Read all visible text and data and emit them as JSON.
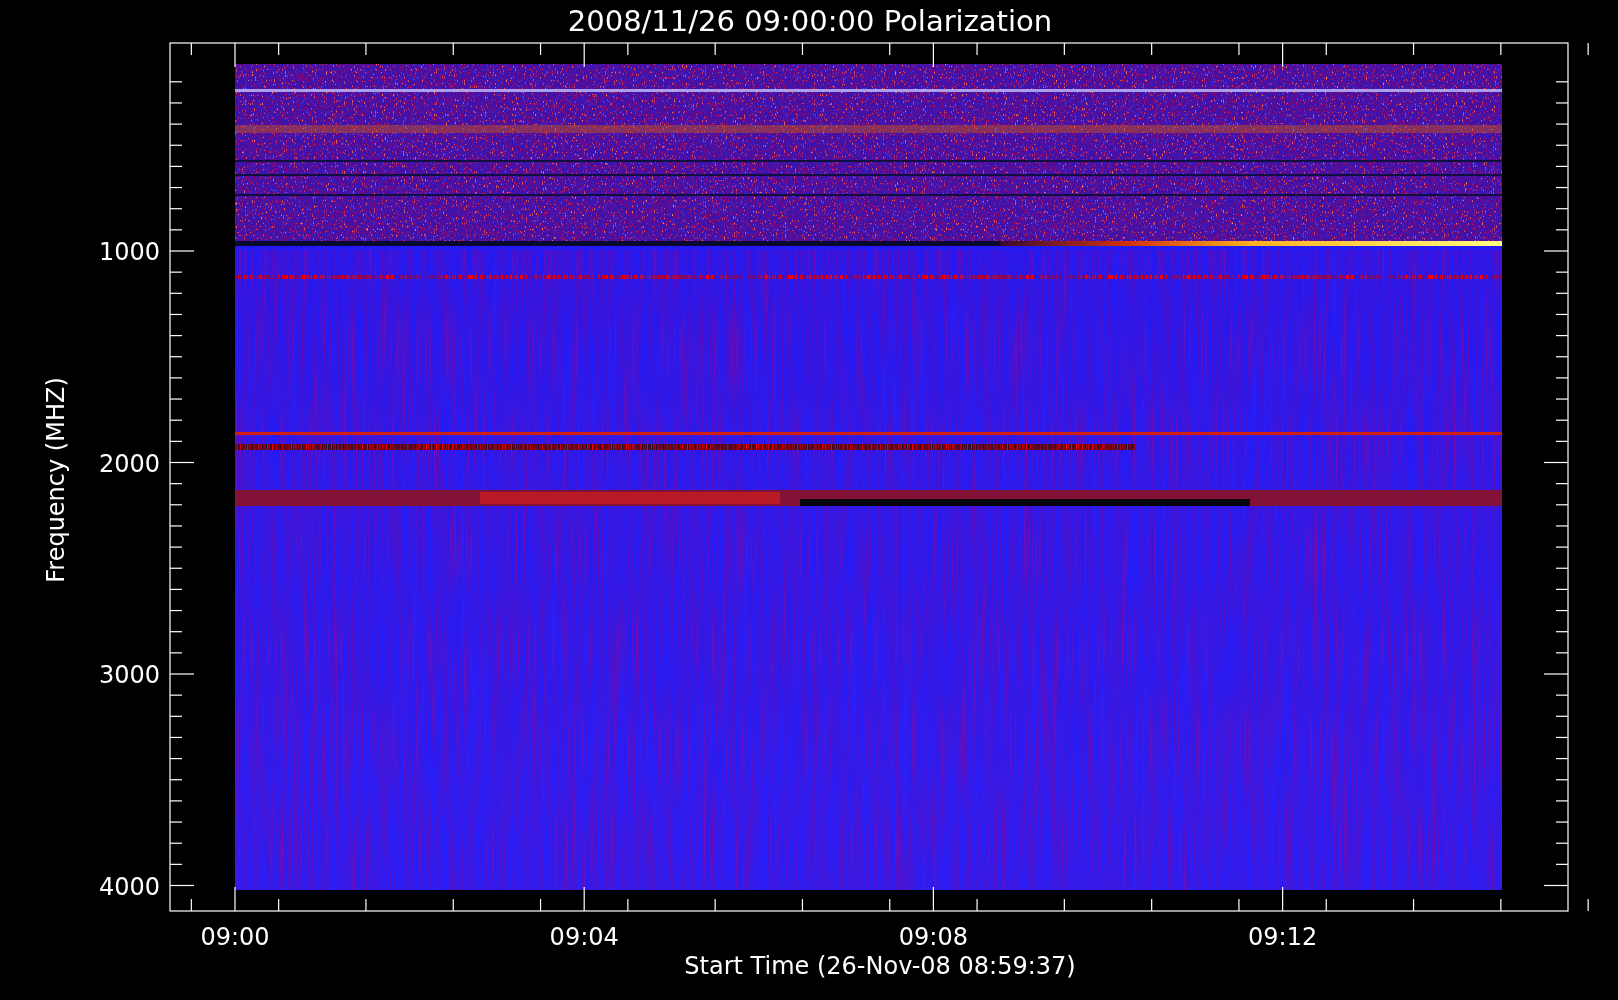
{
  "title": "2008/11/26 09:00:00 Polarization",
  "x_axis": {
    "label": "Start Time (26-Nov-08 08:59:37)",
    "ticks": [
      "09:00",
      "09:04",
      "09:08",
      "09:12"
    ]
  },
  "y_axis": {
    "label": "Frequency (MHZ)",
    "ticks": [
      "1000",
      "2000",
      "3000",
      "4000"
    ]
  }
}
